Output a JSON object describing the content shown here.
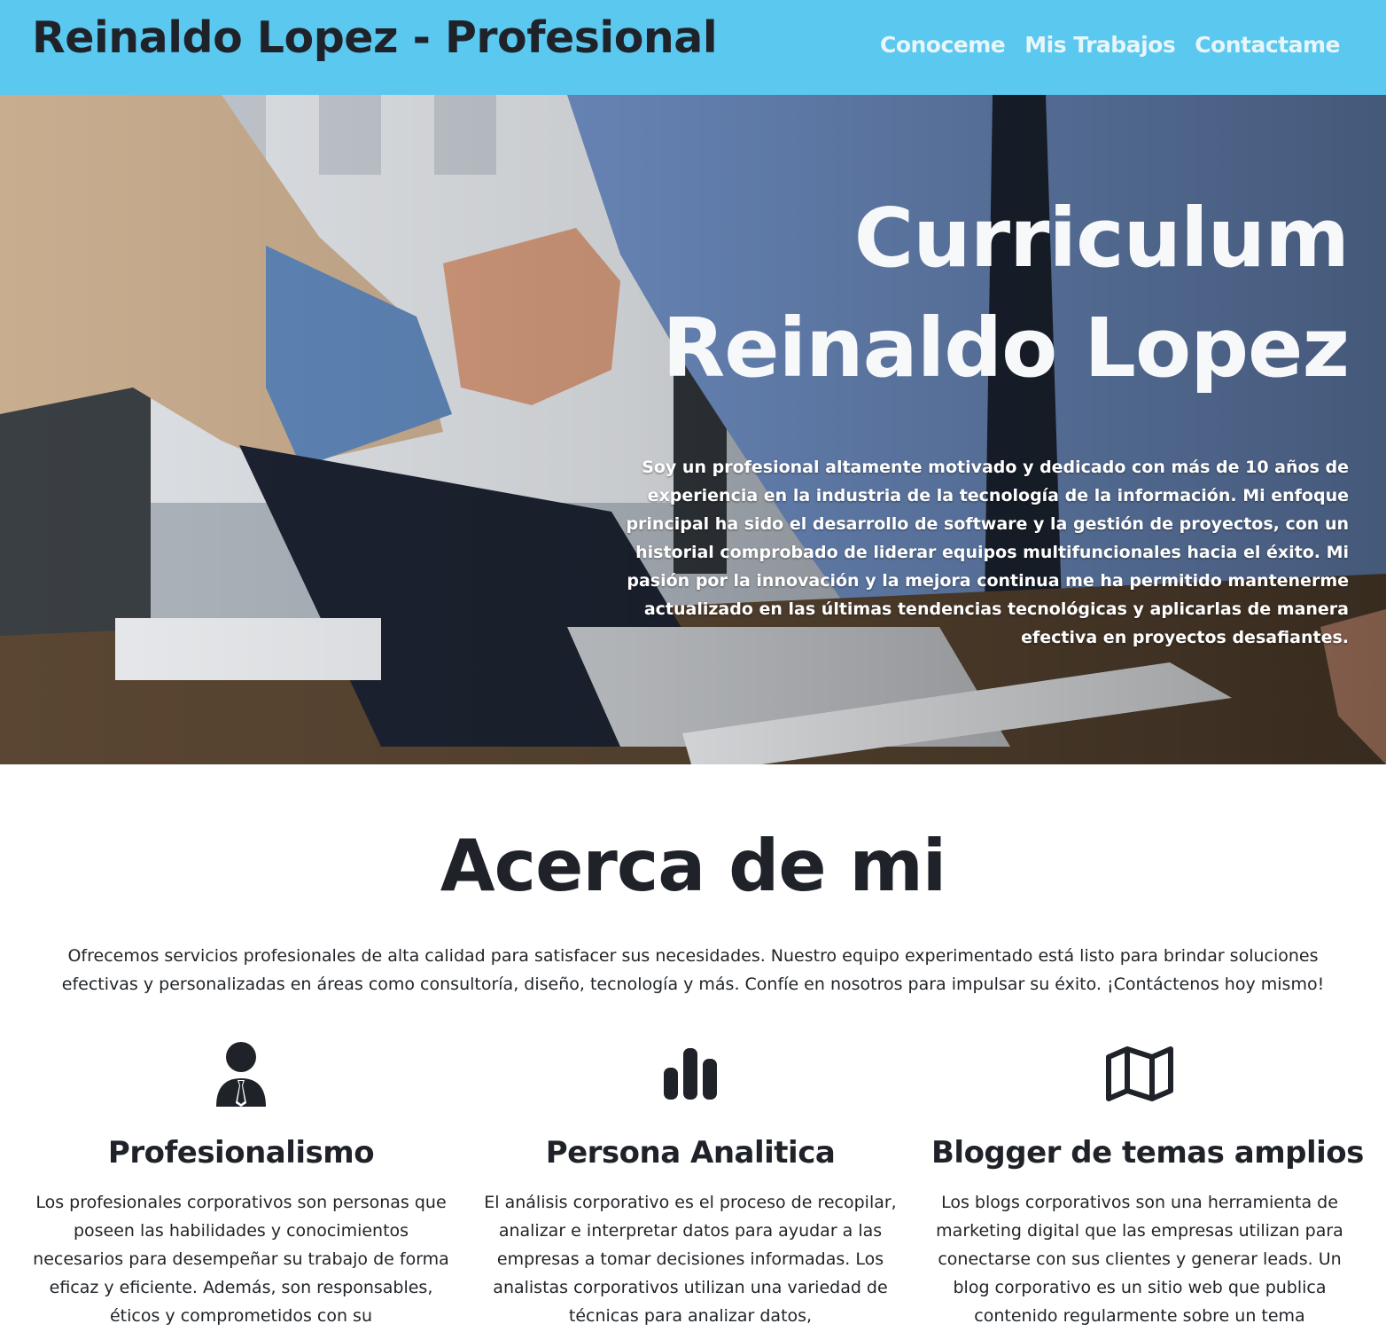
{
  "navbar": {
    "brand": "Reinaldo Lopez - Profesional",
    "links": [
      "Conoceme",
      "Mis Trabajos",
      "Contactame"
    ]
  },
  "hero": {
    "title_line1": "Curriculum",
    "title_line2": "Reinaldo Lopez",
    "text": "Soy un profesional altamente motivado y dedicado con más de 10 años de experiencia en la industria de la tecnología de la información. Mi enfoque principal ha sido el desarrollo de software y la gestión de proyectos, con un historial comprobado de liderar equipos multifuncionales hacia el éxito. Mi pasión por la innovación y la mejora continua me ha permitido mantenerme actualizado en las últimas tendencias tecnológicas y aplicarlas de manera efectiva en proyectos desafiantes."
  },
  "about": {
    "title": "Acerca de mi",
    "text": "Ofrecemos servicios profesionales de alta calidad para satisfacer sus necesidades. Nuestro equipo experimentado está listo para brindar soluciones efectivas y personalizadas en áreas como consultoría, diseño, tecnología y más. Confíe en nosotros para impulsar su éxito. ¡Contáctenos hoy mismo!"
  },
  "features": [
    {
      "icon": "person-tie-icon",
      "title": "Profesionalismo",
      "text": "Los profesionales corporativos son personas que poseen las habilidades y conocimientos necesarios para desempeñar su trabajo de forma eficaz y eficiente. Además, son responsables, éticos y comprometidos con su"
    },
    {
      "icon": "bar-chart-icon",
      "title": "Persona Analitica",
      "text": "El análisis corporativo es el proceso de recopilar, analizar e interpretar datos para ayudar a las empresas a tomar decisiones informadas. Los analistas corporativos utilizan una variedad de técnicas para analizar datos,"
    },
    {
      "icon": "map-icon",
      "title": "Blogger de temas amplios",
      "text": "Los blogs corporativos son una herramienta de marketing digital que las empresas utilizan para conectarse con sus clientes y generar leads. Un blog corporativo es un sitio web que publica contenido regularmente sobre un tema"
    }
  ],
  "colors": {
    "navbar": "#5bc8ef",
    "heading": "#1f2329",
    "nav_link": "#e8f6fc"
  }
}
